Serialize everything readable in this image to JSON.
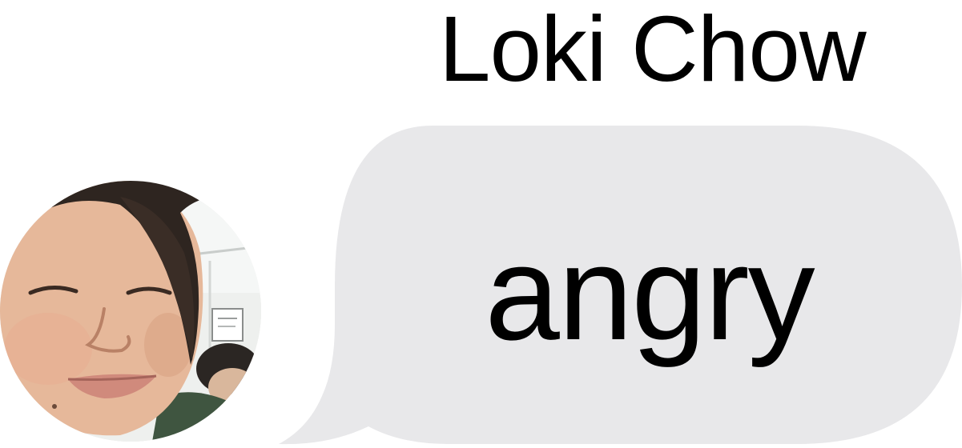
{
  "message": {
    "sender_name": "Loki Chow",
    "text": "angry",
    "bubble_color": "#e8e8ea",
    "text_color": "#000000"
  },
  "avatar": {
    "icon": "contact-photo"
  }
}
